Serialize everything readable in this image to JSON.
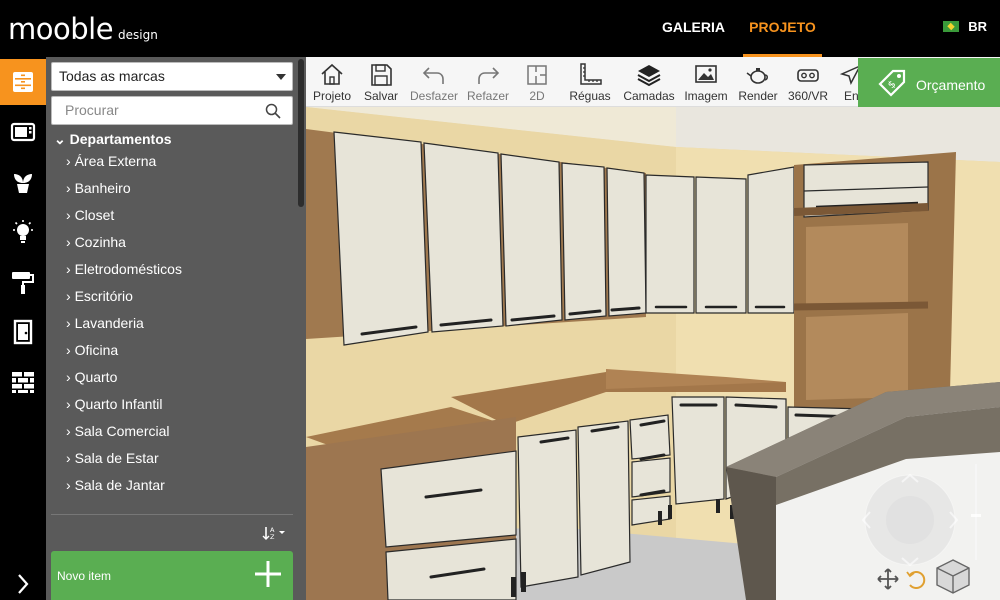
{
  "app": {
    "logo": "mooble",
    "logo_suffix": "design"
  },
  "nav": {
    "galeria": "GALERIA",
    "projeto": "PROJETO",
    "lang": "BR"
  },
  "panel": {
    "brand_select": "Todas as marcas",
    "search_placeholder": "Procurar",
    "department_header": "Departamentos",
    "categories": [
      "Área Externa",
      "Banheiro",
      "Closet",
      "Cozinha",
      "Eletrodomésticos",
      "Escritório",
      "Lavanderia",
      "Oficina",
      "Quarto",
      "Quarto Infantil",
      "Sala Comercial",
      "Sala de Estar",
      "Sala de Jantar"
    ],
    "new_item": "Novo item"
  },
  "rail": [
    "drawer-icon",
    "microwave-icon",
    "plant-icon",
    "lightbulb-icon",
    "paint-roller-icon",
    "door-icon",
    "brick-wall-icon"
  ],
  "toolbar": {
    "tools": [
      "Projeto",
      "Salvar",
      "Desfazer",
      "Refazer",
      "2D",
      "Réguas",
      "Camadas",
      "Imagem",
      "Render",
      "360/VR",
      "Env"
    ],
    "orcamento": "Orçamento"
  },
  "colors": {
    "accent": "#f7931e",
    "green": "#5aae52",
    "panel": "#5a5a5a",
    "topbar": "#000000"
  }
}
